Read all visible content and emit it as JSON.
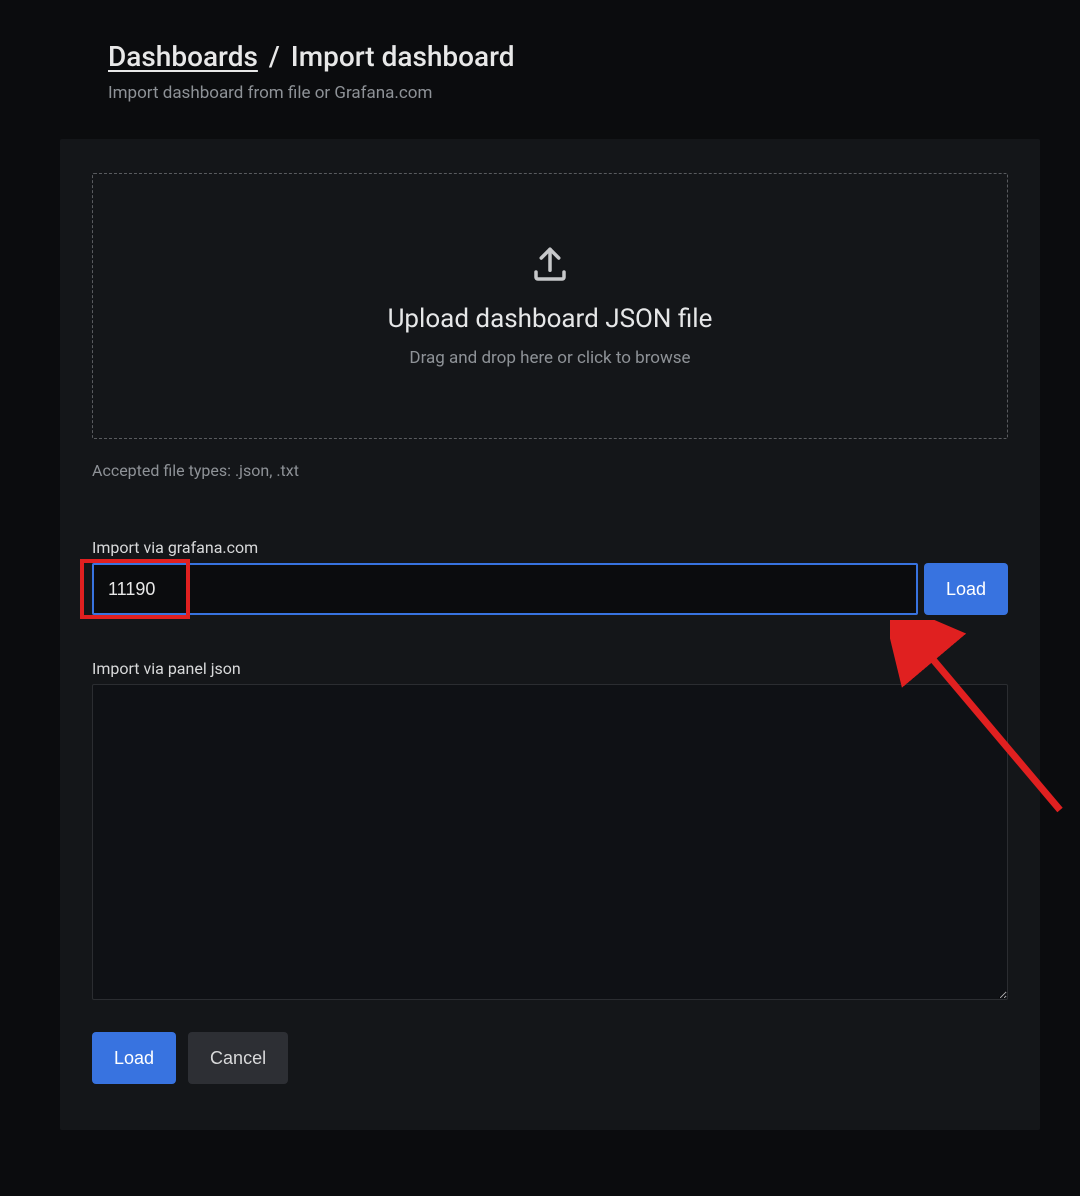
{
  "breadcrumb": {
    "link": "Dashboards",
    "separator": "/",
    "current": "Import dashboard"
  },
  "subtitle": "Import dashboard from file or Grafana.com",
  "dropzone": {
    "title": "Upload dashboard JSON file",
    "subtitle": "Drag and drop here or click to browse"
  },
  "accepted_types": "Accepted file types: .json, .txt",
  "grafana_import": {
    "label": "Import via grafana.com",
    "value": "11190",
    "load_label": "Load"
  },
  "panel_json": {
    "label": "Import via panel json",
    "value": ""
  },
  "actions": {
    "load": "Load",
    "cancel": "Cancel"
  }
}
